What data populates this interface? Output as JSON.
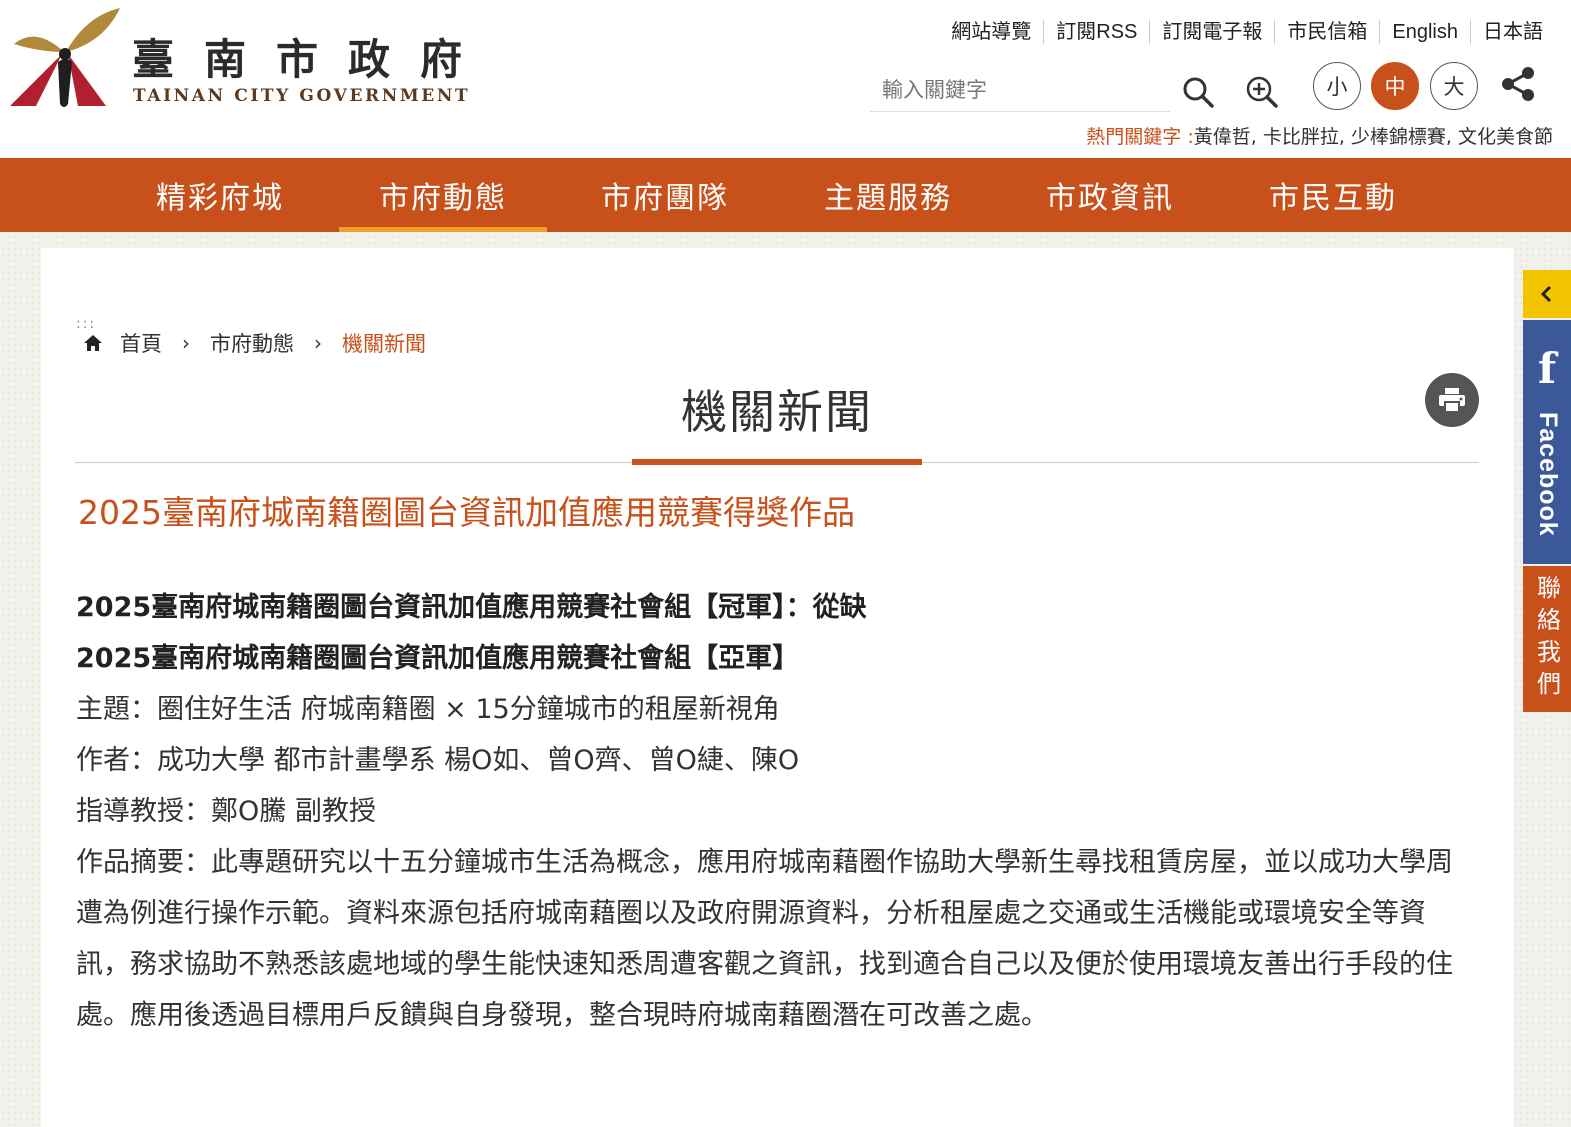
{
  "header": {
    "logo_zh": "臺南市政府",
    "logo_en": "TAINAN CITY GOVERNMENT",
    "top_links": [
      "網站導覽",
      "訂閱RSS",
      "訂閱電子報",
      "市民信箱",
      "English",
      "日本語"
    ],
    "search": {
      "placeholder": "輸入關鍵字",
      "value": ""
    },
    "font_sizes": {
      "small": "小",
      "medium": "中",
      "large": "大"
    },
    "hot_keywords_label": "熱門關鍵字 :",
    "hot_keywords": "黃偉哲, 卡比胖拉, 少棒錦標賽, 文化美食節"
  },
  "nav": {
    "items": [
      "精彩府城",
      "市府動態",
      "市府團隊",
      "主題服務",
      "市政資訊",
      "市民互動"
    ],
    "active_index": 1
  },
  "breadcrumb": {
    "home": "首頁",
    "level1": "市府動態",
    "current": "機關新聞",
    "separator": "›"
  },
  "page": {
    "title": "機關新聞",
    "article_title": "2025臺南府城南籍圈圖台資訊加值應用競賽得獎作品",
    "lines": [
      {
        "text": "2025臺南府城南籍圈圖台資訊加值應用競賽社會組【冠軍】：從缺",
        "bold": true
      },
      {
        "text": "2025臺南府城南籍圈圖台資訊加值應用競賽社會組【亞軍】",
        "bold": true
      },
      {
        "text": "主題：圈住好生活 府城南籍圈 × 15分鐘城市的租屋新視角",
        "bold": false
      },
      {
        "text": "作者：成功大學 都市計畫學系 楊O如、曾O齊、曾O緁、陳O",
        "bold": false
      },
      {
        "text": "指導教授：鄭O騰 副教授",
        "bold": false
      },
      {
        "text": "作品摘要：此專題研究以十五分鐘城市生活為概念，應用府城南藉圈作協助大學新生尋找租賃房屋，並以成功大學周遭為例進行操作示範。資料來源包括府城南藉圈以及政府開源資料，分析租屋處之交通或生活機能或環境安全等資訊，務求協助不熟悉該處地域的學生能快速知悉周遭客觀之資訊，找到適合自己以及便於使用環境友善出行手段的住處。應用後透過目標用戶反饋與自身發現，整合現時府城南藉圈潛在可改善之處。",
        "bold": false
      }
    ]
  },
  "side": {
    "facebook_label": "Facebook",
    "facebook_icon": "f",
    "contact_label": "聯絡我們"
  },
  "colors": {
    "brand_orange": "#c8501b",
    "active_underline": "#f1a027",
    "facebook_blue": "#3b5998",
    "toggle_yellow": "#f2c500"
  }
}
